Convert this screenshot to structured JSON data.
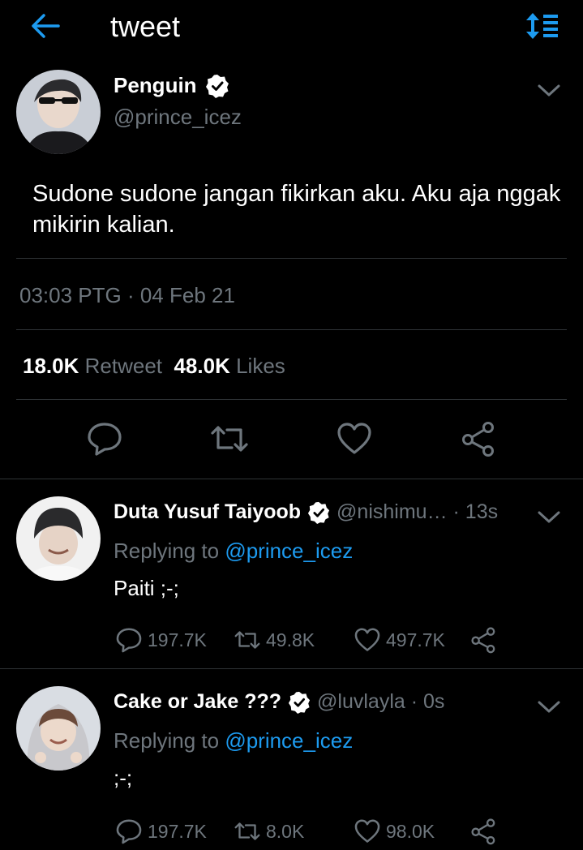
{
  "header": {
    "title": "tweet",
    "back_icon": "arrow-left-icon",
    "sort_icon": "sort-list-icon",
    "accent": "#1d9bf0"
  },
  "tweet": {
    "author_name": "Penguin",
    "handle": "@prince_icez",
    "verified": true,
    "text": "Sudone sudone jangan fikirkan aku. Aku aja nggak mikirin kalian.",
    "timestamp": "03:03 PTG · 04 Feb 21",
    "retweets": "18.0K",
    "retweet_label": "Retweet",
    "likes": "48.0K",
    "likes_label": "Likes"
  },
  "replies": [
    {
      "name": "Duta Yusuf Taiyoob",
      "handle_time": "@nishimu… · 13s",
      "replying_prefix": "Replying to",
      "replying_to": "@prince_icez",
      "text": "Paiti ;-;",
      "reply_count": "197.7K",
      "retweet_count": "49.8K",
      "like_count": "497.7K"
    },
    {
      "name": "Cake or Jake ???",
      "handle_time": "@luvlayla · 0s",
      "replying_prefix": "Replying to",
      "replying_to": "@prince_icez",
      "text": ";-;",
      "reply_count": "197.7K",
      "retweet_count": "8.0K",
      "like_count": "98.0K"
    }
  ]
}
